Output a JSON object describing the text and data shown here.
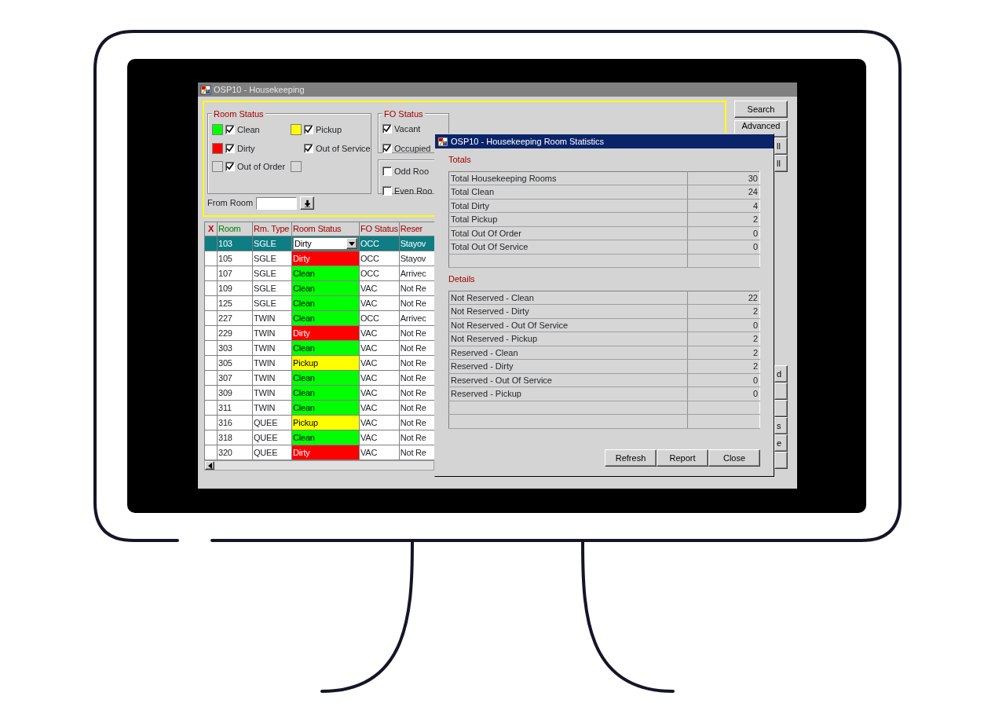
{
  "window": {
    "title": "OSP10 - Housekeeping"
  },
  "filters": {
    "room_status": {
      "legend": "Room Status",
      "items": [
        {
          "label": "Clean",
          "checked": true,
          "color": "#00ff00"
        },
        {
          "label": "Pickup",
          "checked": true,
          "color": "#ffff00"
        },
        {
          "label": "Dirty",
          "checked": true,
          "color": "#ff0000"
        },
        {
          "label": "Out of Service",
          "checked": true
        },
        {
          "label": "Out of Order",
          "checked": true,
          "color": "#d8d8d8"
        },
        {
          "color": "#d8d8d8"
        }
      ]
    },
    "fo_status": {
      "legend": "FO Status",
      "items": [
        {
          "label": "Vacant",
          "checked": true
        },
        {
          "label": "Occupied",
          "checked": true
        }
      ]
    },
    "room_parity": {
      "items": [
        {
          "label": "Odd Roo",
          "checked": false
        },
        {
          "label": "Even Roo",
          "checked": false
        }
      ]
    },
    "from_room": {
      "label": "From Room"
    }
  },
  "side_buttons": [
    {
      "label": "Search",
      "kind": "full"
    },
    {
      "label": "Advanced",
      "kind": "full"
    },
    {
      "label": "ll",
      "kind": "stub"
    },
    {
      "label": "ll",
      "kind": "stub"
    }
  ],
  "lower_side_buttons": [
    {
      "label": "d",
      "kind": "stub"
    },
    {
      "kind": "stub"
    },
    {
      "kind": "stub"
    },
    {
      "label": "s",
      "kind": "stub"
    },
    {
      "label": "e",
      "kind": "stub"
    },
    {
      "kind": "stub"
    }
  ],
  "table": {
    "columns": [
      {
        "label": "X",
        "color": "#c00000"
      },
      {
        "label": "Room",
        "color": "#008000"
      },
      {
        "label": "Rm. Type",
        "color": "#a00000"
      },
      {
        "label": "Room Status",
        "color": "#a00000"
      },
      {
        "label": "FO Status",
        "color": "#a00000"
      },
      {
        "label": "Reser",
        "color": "#a00000"
      }
    ],
    "rows": [
      {
        "room": "103",
        "type": "SGLE",
        "status": "Dirty",
        "fo": "OCC",
        "reservation": "Stayov",
        "selected": true
      },
      {
        "room": "105",
        "type": "SGLE",
        "status": "Dirty",
        "color": "#ff0000",
        "fo": "OCC",
        "reservation": "Stayov",
        "selected": false
      },
      {
        "room": "107",
        "type": "SGLE",
        "status": "Clean",
        "color": "#00ff00",
        "fo": "OCC",
        "reservation": "Arrivec",
        "selected": false
      },
      {
        "room": "109",
        "type": "SGLE",
        "status": "Clean",
        "color": "#00ff00",
        "fo": "VAC",
        "reservation": "Not Re",
        "selected": false
      },
      {
        "room": "125",
        "type": "SGLE",
        "status": "Clean",
        "color": "#00ff00",
        "fo": "VAC",
        "reservation": "Not Re",
        "selected": false
      },
      {
        "room": "227",
        "type": "TWIN",
        "status": "Clean",
        "color": "#00ff00",
        "fo": "OCC",
        "reservation": "Arrivec",
        "selected": false
      },
      {
        "room": "229",
        "type": "TWIN",
        "status": "Dirty",
        "color": "#ff0000",
        "fo": "VAC",
        "reservation": "Not Re",
        "selected": false
      },
      {
        "room": "303",
        "type": "TWIN",
        "status": "Clean",
        "color": "#00ff00",
        "fo": "VAC",
        "reservation": "Not Re",
        "selected": false
      },
      {
        "room": "305",
        "type": "TWIN",
        "status": "Pickup",
        "color": "#ffff00",
        "fo": "VAC",
        "reservation": "Not Re",
        "selected": false
      },
      {
        "room": "307",
        "type": "TWIN",
        "status": "Clean",
        "color": "#00ff00",
        "fo": "VAC",
        "reservation": "Not Re",
        "selected": false
      },
      {
        "room": "309",
        "type": "TWIN",
        "status": "Clean",
        "color": "#00ff00",
        "fo": "VAC",
        "reservation": "Not Re",
        "selected": false
      },
      {
        "room": "311",
        "type": "TWIN",
        "status": "Clean",
        "color": "#00ff00",
        "fo": "VAC",
        "reservation": "Not Re",
        "selected": false
      },
      {
        "room": "316",
        "type": "QUEE",
        "status": "Pickup",
        "color": "#ffff00",
        "fo": "VAC",
        "reservation": "Not Re",
        "selected": false
      },
      {
        "room": "318",
        "type": "QUEE",
        "status": "Clean",
        "color": "#00ff00",
        "fo": "VAC",
        "reservation": "Not Re",
        "selected": false
      },
      {
        "room": "320",
        "type": "QUEE",
        "status": "Dirty",
        "color": "#ff0000",
        "fo": "VAC",
        "reservation": "Not Re",
        "selected": false
      }
    ]
  },
  "dialog": {
    "title": "OSP10 - Housekeeping Room Statistics",
    "sections": [
      {
        "heading": "Totals",
        "rows": [
          {
            "label": "Total Housekeeping Rooms",
            "value": "30"
          },
          {
            "label": "Total Clean",
            "value": "24"
          },
          {
            "label": "Total Dirty",
            "value": "4"
          },
          {
            "label": "Total Pickup",
            "value": "2"
          },
          {
            "label": "Total Out Of Order",
            "value": "0"
          },
          {
            "label": "Total Out Of Service",
            "value": "0"
          }
        ]
      },
      {
        "heading": "Details",
        "rows": [
          {
            "label": "Not Reserved - Clean",
            "value": "22"
          },
          {
            "label": "Not Reserved - Dirty",
            "value": "2"
          },
          {
            "label": "Not Reserved - Out Of Service",
            "value": "0"
          },
          {
            "label": "Not Reserved - Pickup",
            "value": "2"
          },
          {
            "label": "Reserved - Clean",
            "value": "2"
          },
          {
            "label": "Reserved - Dirty",
            "value": "2"
          },
          {
            "label": "Reserved - Out Of Service",
            "value": "0"
          },
          {
            "label": "Reserved - Pickup",
            "value": "0"
          }
        ]
      }
    ],
    "buttons": [
      "Refresh",
      "Report",
      "Close"
    ]
  }
}
